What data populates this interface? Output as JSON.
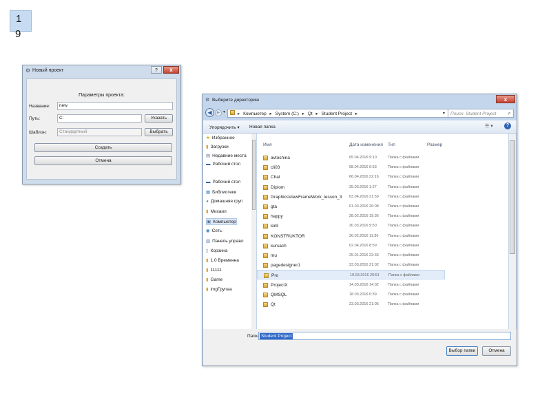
{
  "slide": {
    "number_line1": "1",
    "number_line2": "9"
  },
  "new_project_dialog": {
    "title": "Новый проект",
    "help_label": "?",
    "close_label": "x",
    "section_title": "Параметры проекта:",
    "name_label": "Название:",
    "name_value": "new",
    "path_label": "Путь:",
    "path_value": "C:",
    "path_button": "Указать",
    "template_label": "Шаблон:",
    "template_value": "Стандартный",
    "template_button": "Выбрать",
    "create_button": "Создать",
    "cancel_button": "Отмена"
  },
  "folder_dialog": {
    "title": "Выберите директорию",
    "close_label": "x",
    "breadcrumbs": [
      "Компьютер",
      "System (C:)",
      "Qt",
      "Student Project"
    ],
    "search_placeholder": "Поиск: Student Project",
    "organize_label": "Упорядочить ▾",
    "new_folder_label": "Новая папка",
    "nav_items": [
      {
        "label": "Избранное",
        "icon": "star-icon"
      },
      {
        "label": "Загрузки",
        "icon": "folder-icon"
      },
      {
        "label": "Недавние места",
        "icon": "recent-places-icon"
      },
      {
        "label": "Рабочий стол",
        "icon": "desktop-icon"
      },
      {
        "label": "Рабочий стол",
        "icon": "desktop-icon"
      },
      {
        "label": "Библиотеки",
        "icon": "library-icon"
      },
      {
        "label": "Домашняя груп",
        "icon": "homegroup-icon"
      },
      {
        "label": "Михаил",
        "icon": "user-folder-icon"
      },
      {
        "label": "Компьютер",
        "icon": "computer-icon"
      },
      {
        "label": "Сеть",
        "icon": "network-icon"
      },
      {
        "label": "Панель управл",
        "icon": "control-panel-icon"
      },
      {
        "label": "Корзина",
        "icon": "recycle-bin-icon"
      },
      {
        "label": "1.0 Временна",
        "icon": "folder-icon"
      },
      {
        "label": "11111",
        "icon": "folder-icon"
      },
      {
        "label": "Game",
        "icon": "folder-icon"
      },
      {
        "label": "imgГрупаа",
        "icon": "folder-icon"
      }
    ],
    "columns": [
      "Имя",
      "Дата изменения",
      "Тип",
      "Размер"
    ],
    "files": [
      {
        "name": "avtoshina",
        "date": "05.04.2016 9:10",
        "type": "Папка с файлами"
      },
      {
        "name": "cli03",
        "date": "08.04.2016 0:53",
        "type": "Папка с файлами"
      },
      {
        "name": "Chat",
        "date": "06.04.2016 22:16",
        "type": "Папка с файлами"
      },
      {
        "name": "Diplom",
        "date": "25.03.2016 1:27",
        "type": "Папка с файлами"
      },
      {
        "name": "GraphicsViewFrameWork_lesson_3",
        "date": "03.04.2016 21:59",
        "type": "Папка с файлами"
      },
      {
        "name": "gta",
        "date": "01.03.2016 20:08",
        "type": "Папка с файлами"
      },
      {
        "name": "happy",
        "date": "28.02.2016 19:36",
        "type": "Папка с файлами"
      },
      {
        "name": "kirill",
        "date": "30.03.2016 9:50",
        "type": "Папка с файлами"
      },
      {
        "name": "KONSTRUKTOR",
        "date": "26.02.2016 11:36",
        "type": "Папка с файлами"
      },
      {
        "name": "kursach",
        "date": "02.04.2016 8:59",
        "type": "Папка с файлами"
      },
      {
        "name": "mu",
        "date": "25.01.2016 22:33",
        "type": "Папка с файлами"
      },
      {
        "name": "pagedesigner1",
        "date": "23.03.2016 21:02",
        "type": "Папка с файлами"
      },
      {
        "name": "Pro",
        "date": "10.03.2016 20:51",
        "type": "Папка с файлами"
      },
      {
        "name": "ProjectX",
        "date": "14.03.2016 14:02",
        "type": "Папка с файлами"
      },
      {
        "name": "QMSQL",
        "date": "18.03.2016 0:39",
        "type": "Папка с файлами"
      },
      {
        "name": "Qt",
        "date": "23.03.2016 21:05",
        "type": "Папка с файлами"
      }
    ],
    "folder_label": "Папка:",
    "folder_value": "Student Project",
    "select_button": "Выбор папки",
    "cancel_button": "Отмена"
  }
}
